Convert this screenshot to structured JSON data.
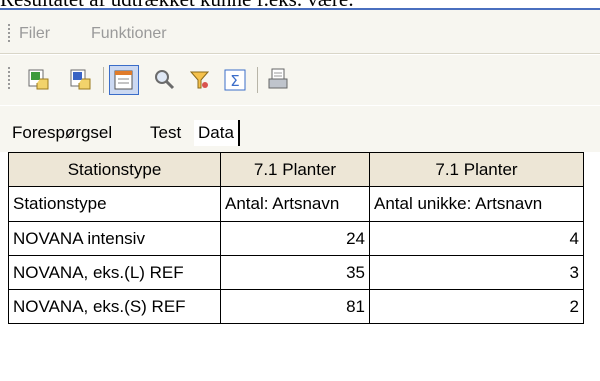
{
  "document": {
    "caption_fragment": "Resultatet af udtrækket kunne f.eks. være:"
  },
  "menu": {
    "items": [
      "Filer",
      "Funktioner"
    ]
  },
  "toolbar": {
    "buttons": [
      {
        "icon": "export-excel-icon",
        "active": false
      },
      {
        "icon": "export-word-icon",
        "active": false
      },
      {
        "icon": "form-view-icon",
        "active": true
      },
      {
        "icon": "search-icon",
        "active": false
      },
      {
        "icon": "filter-icon",
        "active": false
      },
      {
        "icon": "sum-icon",
        "active": false
      },
      {
        "icon": "print-icon",
        "active": false
      }
    ]
  },
  "tabs": {
    "labels": [
      "Forespørgsel",
      "Test",
      "Data"
    ],
    "active": "Data"
  },
  "grid": {
    "header": [
      "Stationstype",
      "7.1 Planter",
      "7.1 Planter"
    ],
    "subheader": [
      "Stationstype",
      "Antal: Artsnavn",
      "Antal unikke: Artsnavn"
    ],
    "rows": [
      [
        "NOVANA intensiv",
        "24",
        "4"
      ],
      [
        "NOVANA, eks.(L) REF",
        "35",
        "3"
      ],
      [
        "NOVANA, eks.(S) REF",
        "81",
        "2"
      ]
    ]
  }
}
